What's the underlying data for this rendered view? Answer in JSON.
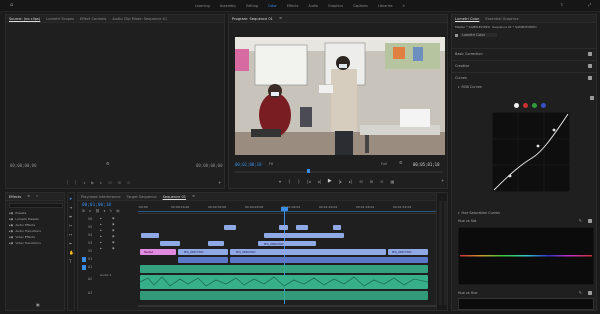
{
  "header": {
    "workspaces": [
      "Learning",
      "Assembly",
      "Editing",
      "Color",
      "Effects",
      "Audio",
      "Graphics",
      "Captions",
      "Libraries"
    ],
    "active_workspace": "Color"
  },
  "source_panel": {
    "tabs": [
      "Source: (no clips)",
      "Lumetri Scopes",
      "Effect Controls",
      "Audio Clip Mixer: Sequence 01"
    ],
    "active_tab_index": 0,
    "timecode_left": "00;00;00;00",
    "timecode_right": "00;00;00;00"
  },
  "program_panel": {
    "title": "Program: Sequence 01",
    "timecode_left": "00;01;00;18",
    "fit": "Fit",
    "quality": "Full",
    "timecode_right": "00;05;01;18"
  },
  "lumetri": {
    "tabs": [
      "Lumetri Color",
      "Essential Graphics"
    ],
    "master": "Master * SAMPLEVIDEO",
    "sequence": "Sequence 01 * SAMPLEVIDEO",
    "preset": "Lumetri Color",
    "sections": [
      "Basic Correction",
      "Creative",
      "Curves"
    ],
    "rgb_curves": "RGB Curves",
    "hue_sat": "Hue Saturation Curves",
    "hue_vs_sat": "Hue vs Sat",
    "hue_vs_hue": "Hue vs Hue"
  },
  "effects_panel": {
    "tabs": [
      "Effects"
    ],
    "items": [
      "Presets",
      "Lumetri Presets",
      "Audio Effects",
      "Audio Transitions",
      "Video Effects",
      "Video Transitions"
    ]
  },
  "timeline": {
    "tabs": [
      "Playhead Interference",
      "Target Sequence",
      "Sequence 01"
    ],
    "active_tab_index": 2,
    "timecode": "00;01;00;18",
    "ruler": [
      ":00;00",
      "00;00;16;00",
      "00;00;32;00",
      "00;00;48;00",
      "00;01;04;02",
      "00;01;20;02",
      "00;01;36;02",
      "00;01;52;02"
    ],
    "tracks": [
      "V6",
      "V5",
      "V4",
      "V3",
      "V2",
      "V1",
      "A1",
      "A2",
      "A3"
    ],
    "audio_label": "Audio 1",
    "clip_labels": [
      "MVI_0090.MOV",
      "MVI_0097.MOV",
      "MVI_0099.MOV",
      "Nested"
    ]
  },
  "colors": {
    "accent": "#3a8ee6",
    "video_clip": "#8fa9e6",
    "nested_clip": "#e28ae0",
    "audio_clip": "#37b08a"
  }
}
